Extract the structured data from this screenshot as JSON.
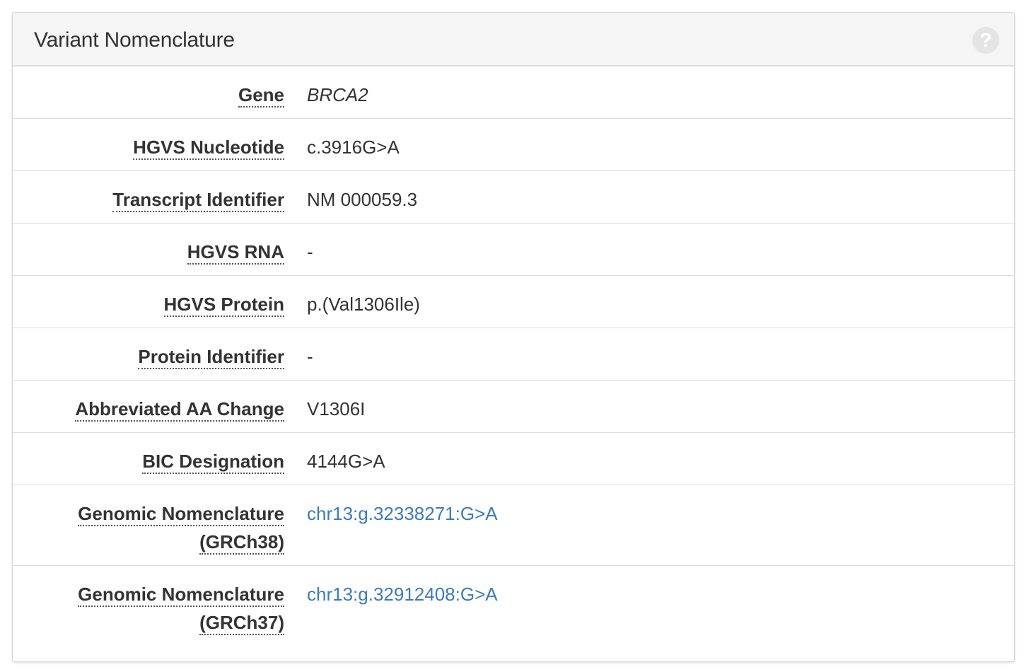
{
  "panel": {
    "title": "Variant Nomenclature",
    "help_icon": "question-circle-icon",
    "help_glyph": "?"
  },
  "rows": [
    {
      "label": "Gene",
      "value": "BRCA2"
    },
    {
      "label": "HGVS Nucleotide",
      "value": "c.3916G>A"
    },
    {
      "label": "Transcript Identifier",
      "value": "NM 000059.3"
    },
    {
      "label": "HGVS RNA",
      "value": "-"
    },
    {
      "label": "HGVS Protein",
      "value": "p.(Val1306Ile)"
    },
    {
      "label": "Protein Identifier",
      "value": "-"
    },
    {
      "label": "Abbreviated AA Change",
      "value": "V1306I"
    },
    {
      "label": "BIC Designation",
      "value": "4144G>A"
    },
    {
      "label_line1": "Genomic Nomenclature",
      "label_line2": "(GRCh38)",
      "value": "chr13:g.32338271:G>A"
    },
    {
      "label_line1": "Genomic Nomenclature",
      "label_line2": "(GRCh37)",
      "value": "chr13:g.32912408:G>A"
    }
  ],
  "colors": {
    "link": "#3a7bbf",
    "heading_bg": "#f5f5f5",
    "text": "#333333"
  }
}
